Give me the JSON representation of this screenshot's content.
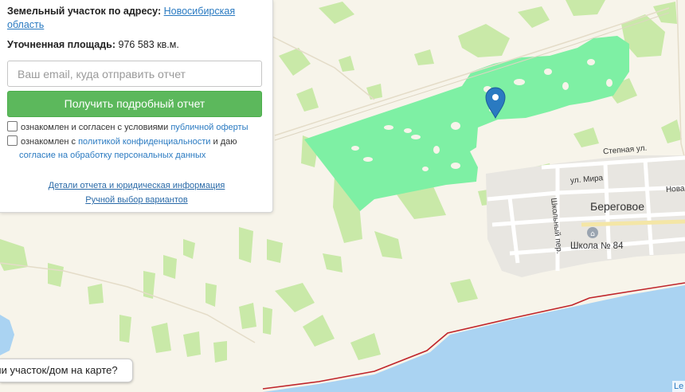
{
  "panel": {
    "address_label": "Земельный участок по адресу:",
    "address_link": "Новосибирская область",
    "area_label": "Уточненная площадь:",
    "area_value": "976 583 кв.м.",
    "email_placeholder": "Ваш email, куда отправить отчет",
    "submit_label": "Получить подробный отчет",
    "agree1_text": "ознакомлен и согласен с условиями ",
    "agree1_link": "публичной оферты",
    "agree2_text_a": "ознакомлен с ",
    "agree2_link_a": "политикой конфиденциальности",
    "agree2_text_b": " и даю",
    "agree2_link_b": "согласие на обработку персональных данных",
    "details_link": "Детали отчета и юридическая информация",
    "manual_link": "Ручной выбор вариантов"
  },
  "map": {
    "labels": {
      "village": "Береговое",
      "street_stepnaya": "Степная ул.",
      "street_mira": "ул. Мира",
      "street_novaya": "Новая",
      "street_shkolny": "Школьный пер.",
      "school": "Школа № 84"
    },
    "bottom_tip": "ли участок/дом на карте?",
    "attribution": "Le"
  },
  "colors": {
    "parcel": "#7ef0a4",
    "forest": "#c9e9a8",
    "water": "#aad3f2",
    "boundary": "#c0242a",
    "button": "#5cb85c",
    "link": "#2a7ac1",
    "marker": "#2a7ac1"
  }
}
